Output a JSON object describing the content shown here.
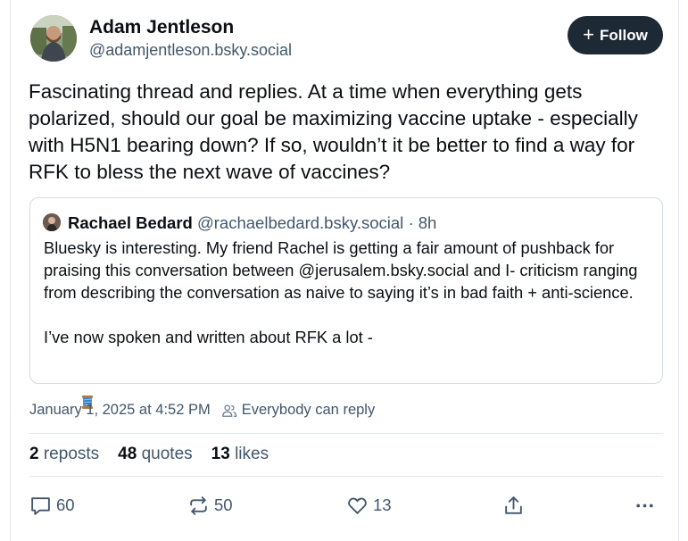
{
  "author": {
    "name": "Adam Jentleson",
    "handle": "@adamjentleson.bsky.social"
  },
  "follow_label": "Follow",
  "post_text": "Fascinating thread and replies. At a time when everything gets polarized, should our goal be maximizing vaccine uptake - especially with H5N1 bearing down? If so, wouldn’t it be better to find a way for RFK to bless the next wave of vaccines?",
  "quote": {
    "name": "Rachael Bedard",
    "handle": "@rachaelbedard.bsky.social",
    "time": "· 8h",
    "paragraph1": "Bluesky is interesting. My friend Rachel is getting a fair amount of pushback for praising this conversation between @jerusalem.bsky.social and I- criticism ranging from describing the conversation as naive to saying it’s in bad faith + anti-science.",
    "paragraph2": "I’ve now spoken and written about RFK a lot -"
  },
  "meta": {
    "timestamp": "January 1, 2025 at 4:52 PM",
    "reply_setting": "Everybody can reply"
  },
  "stats": {
    "reposts_count": "2",
    "reposts_label": "reposts",
    "quotes_count": "48",
    "quotes_label": "quotes",
    "likes_count": "13",
    "likes_label": "likes"
  },
  "actions": {
    "reply_count": "60",
    "repost_count": "50",
    "like_count": "13"
  },
  "icons": [
    "plus-icon",
    "people-icon",
    "thread-emoji-icon",
    "reply-icon",
    "repost-icon",
    "heart-icon",
    "share-icon",
    "more-icon"
  ],
  "colors": {
    "follow_button": "#1e2936",
    "secondary_text": "#42576c",
    "border": "#d4dbe2"
  }
}
